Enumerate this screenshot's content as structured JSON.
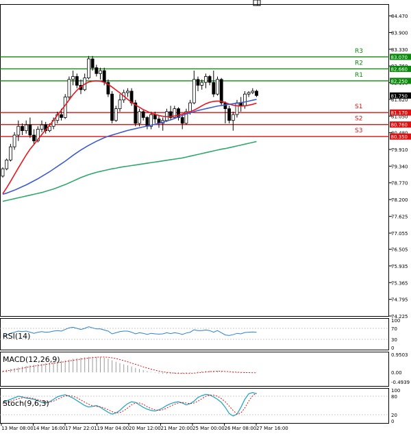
{
  "chart_data": {
    "type": "candlestick",
    "price_axis": {
      "ticks": [
        "84.470",
        "83.900",
        "83.330",
        "82.760",
        "82.190",
        "81.620",
        "81.050",
        "80.480",
        "79.910",
        "79.340",
        "78.770",
        "78.200",
        "77.625",
        "77.055",
        "76.505",
        "75.935",
        "75.365",
        "74.795",
        "74.225"
      ],
      "ylim": [
        74.225,
        84.87
      ]
    },
    "current_price": "81.750",
    "levels": [
      {
        "label": "R3",
        "value": 83.07,
        "tag": "83.070",
        "type": "resistance"
      },
      {
        "label": "R2",
        "value": 82.66,
        "tag": "82.660",
        "type": "resistance"
      },
      {
        "label": "R1",
        "value": 82.25,
        "tag": "82.250",
        "type": "resistance"
      },
      {
        "label": "S1",
        "value": 81.17,
        "tag": "81.170",
        "type": "support"
      },
      {
        "label": "S2",
        "value": 80.76,
        "tag": "80.760",
        "type": "support"
      },
      {
        "label": "S3",
        "value": 80.35,
        "tag": "80.350",
        "type": "support"
      }
    ],
    "time_labels": [
      "13 Mar 08:00",
      "14 Mar 16:00",
      "17 Mar 22:01",
      "19 Mar 04:00",
      "20 Mar 12:00",
      "21 Mar 20:00",
      "25 Mar 00:00",
      "26 Mar 08:00",
      "27 Mar 16:00"
    ],
    "candles": [
      [
        79.0,
        79.3,
        78.95,
        79.25
      ],
      [
        79.25,
        79.6,
        79.2,
        79.55
      ],
      [
        79.55,
        80.1,
        79.5,
        80.0
      ],
      [
        80.0,
        80.5,
        79.9,
        80.4
      ],
      [
        80.4,
        80.9,
        80.2,
        80.7
      ],
      [
        80.7,
        80.8,
        80.4,
        80.55
      ],
      [
        80.55,
        80.9,
        80.45,
        80.75
      ],
      [
        80.75,
        81.0,
        80.3,
        80.4
      ],
      [
        80.4,
        80.6,
        80.1,
        80.2
      ],
      [
        80.2,
        80.7,
        80.15,
        80.6
      ],
      [
        80.6,
        80.9,
        80.5,
        80.75
      ],
      [
        80.75,
        80.85,
        80.45,
        80.55
      ],
      [
        80.55,
        80.8,
        80.5,
        80.7
      ],
      [
        80.7,
        81.0,
        80.6,
        80.9
      ],
      [
        80.9,
        81.2,
        80.8,
        81.1
      ],
      [
        81.1,
        81.3,
        80.9,
        81.0
      ],
      [
        81.0,
        81.8,
        80.95,
        81.7
      ],
      [
        81.7,
        82.4,
        81.6,
        82.3
      ],
      [
        82.3,
        82.6,
        82.1,
        82.4
      ],
      [
        82.4,
        82.5,
        82.0,
        82.1
      ],
      [
        82.1,
        82.3,
        81.8,
        81.95
      ],
      [
        81.95,
        82.5,
        81.9,
        82.35
      ],
      [
        82.35,
        83.1,
        82.3,
        83.0
      ],
      [
        83.0,
        83.1,
        82.6,
        82.7
      ],
      [
        82.7,
        82.8,
        82.4,
        82.5
      ],
      [
        82.5,
        82.7,
        82.3,
        82.6
      ],
      [
        82.6,
        82.7,
        82.1,
        82.2
      ],
      [
        82.2,
        82.3,
        81.7,
        81.8
      ],
      [
        81.8,
        81.9,
        80.8,
        80.9
      ],
      [
        80.9,
        81.4,
        80.85,
        81.3
      ],
      [
        81.3,
        81.8,
        81.2,
        81.6
      ],
      [
        81.6,
        81.95,
        81.5,
        81.85
      ],
      [
        81.85,
        82.0,
        81.7,
        81.9
      ],
      [
        81.9,
        82.0,
        81.4,
        81.5
      ],
      [
        81.5,
        81.6,
        80.7,
        80.8
      ],
      [
        80.8,
        81.3,
        80.7,
        81.2
      ],
      [
        81.2,
        81.25,
        80.9,
        81.0
      ],
      [
        81.0,
        81.05,
        80.6,
        80.7
      ],
      [
        80.7,
        81.2,
        80.6,
        81.1
      ],
      [
        81.1,
        81.2,
        80.8,
        80.95
      ],
      [
        80.95,
        81.05,
        80.65,
        80.8
      ],
      [
        80.8,
        81.0,
        80.55,
        80.9
      ],
      [
        80.9,
        81.3,
        80.85,
        81.2
      ],
      [
        81.2,
        81.4,
        80.9,
        81.0
      ],
      [
        81.0,
        81.4,
        80.95,
        81.3
      ],
      [
        81.3,
        81.35,
        80.9,
        81.0
      ],
      [
        81.0,
        81.1,
        80.6,
        80.8
      ],
      [
        80.8,
        81.3,
        80.75,
        81.2
      ],
      [
        81.2,
        81.6,
        81.1,
        81.5
      ],
      [
        81.5,
        82.6,
        81.45,
        82.3
      ],
      [
        82.3,
        82.4,
        81.9,
        82.1
      ],
      [
        82.1,
        82.3,
        81.95,
        82.2
      ],
      [
        82.2,
        82.5,
        82.0,
        82.4
      ],
      [
        82.4,
        82.45,
        82.1,
        82.2
      ],
      [
        82.2,
        82.6,
        81.7,
        81.8
      ],
      [
        81.8,
        82.4,
        81.75,
        82.3
      ],
      [
        82.3,
        82.35,
        81.4,
        81.5
      ],
      [
        81.5,
        81.55,
        80.8,
        81.3
      ],
      [
        81.3,
        81.4,
        80.8,
        80.9
      ],
      [
        80.9,
        81.2,
        80.55,
        81.1
      ],
      [
        81.1,
        81.6,
        81.0,
        81.5
      ],
      [
        81.5,
        81.7,
        81.2,
        81.4
      ],
      [
        81.4,
        81.9,
        81.3,
        81.8
      ],
      [
        81.8,
        81.9,
        81.7,
        81.85
      ],
      [
        81.85,
        82.0,
        81.8,
        81.9
      ],
      [
        81.9,
        81.95,
        81.7,
        81.75
      ]
    ],
    "series": [
      {
        "name": "MA fast",
        "color": "#e8141e",
        "values": [
          78.4,
          78.6,
          78.82,
          79.05,
          79.28,
          79.5,
          79.72,
          79.92,
          80.08,
          80.25,
          80.42,
          80.58,
          80.74,
          80.9,
          81.08,
          81.25,
          81.42,
          81.6,
          81.78,
          81.93,
          82.05,
          82.14,
          82.21,
          82.24,
          82.25,
          82.24,
          82.2,
          82.13,
          82.04,
          81.94,
          81.84,
          81.73,
          81.62,
          81.52,
          81.43,
          81.35,
          81.27,
          81.21,
          81.15,
          81.11,
          81.07,
          81.04,
          81.03,
          81.03,
          81.05,
          81.08,
          81.12,
          81.16,
          81.2,
          81.25,
          81.32,
          81.4,
          81.47,
          81.52,
          81.55,
          81.56,
          81.55,
          81.51,
          81.46,
          81.42,
          81.4,
          81.39,
          81.4,
          81.42,
          81.45,
          81.49
        ]
      },
      {
        "name": "MA mid",
        "color": "#3c5ad2",
        "values": [
          78.38,
          78.42,
          78.47,
          78.52,
          78.58,
          78.64,
          78.7,
          78.77,
          78.84,
          78.91,
          78.99,
          79.07,
          79.15,
          79.24,
          79.33,
          79.42,
          79.51,
          79.61,
          79.71,
          79.8,
          79.89,
          79.97,
          80.05,
          80.12,
          80.19,
          80.25,
          80.31,
          80.36,
          80.4,
          80.44,
          80.48,
          80.52,
          80.56,
          80.59,
          80.62,
          80.65,
          80.68,
          80.71,
          80.74,
          80.77,
          80.8,
          80.84,
          80.88,
          80.92,
          80.97,
          81.02,
          81.07,
          81.12,
          81.16,
          81.2,
          81.24,
          81.27,
          81.3,
          81.33,
          81.36,
          81.39,
          81.41,
          81.43,
          81.45,
          81.47,
          81.49,
          81.51,
          81.53,
          81.56,
          81.59,
          81.62
        ]
      },
      {
        "name": "MA slow",
        "color": "#2ea86a",
        "values": [
          78.14,
          78.17,
          78.2,
          78.23,
          78.26,
          78.29,
          78.32,
          78.35,
          78.38,
          78.41,
          78.44,
          78.48,
          78.52,
          78.56,
          78.61,
          78.66,
          78.71,
          78.77,
          78.83,
          78.89,
          78.95,
          79.0,
          79.05,
          79.09,
          79.13,
          79.16,
          79.19,
          79.22,
          79.25,
          79.27,
          79.3,
          79.32,
          79.34,
          79.36,
          79.38,
          79.4,
          79.42,
          79.44,
          79.46,
          79.48,
          79.5,
          79.52,
          79.54,
          79.56,
          79.58,
          79.6,
          79.62,
          79.65,
          79.68,
          79.71,
          79.74,
          79.77,
          79.8,
          79.83,
          79.86,
          79.89,
          79.92,
          79.94,
          79.97,
          80.0,
          80.03,
          80.06,
          80.09,
          80.12,
          80.15,
          80.18
        ]
      }
    ],
    "indicators": {
      "rsi": {
        "label": "RSI(14)",
        "ticks": [
          "100",
          "70",
          "30",
          "0"
        ],
        "ylim": [
          0,
          100
        ],
        "values": [
          42,
          46,
          52,
          56,
          60,
          58,
          60,
          56,
          52,
          56,
          58,
          56,
          57,
          60,
          62,
          60,
          66,
          72,
          74,
          70,
          66,
          70,
          76,
          72,
          68,
          68,
          64,
          60,
          50,
          54,
          58,
          60,
          60,
          56,
          50,
          54,
          52,
          48,
          52,
          50,
          49,
          50,
          54,
          51,
          54,
          52,
          48,
          53,
          56,
          65,
          62,
          62,
          64,
          62,
          56,
          62,
          54,
          46,
          44,
          47,
          52,
          50,
          55,
          56,
          57,
          56
        ]
      },
      "macd": {
        "label": "MACD(12,26,9)",
        "ticks": [
          "0.9503",
          "0.00",
          "-0.4939"
        ],
        "ylim": [
          -0.5,
          0.95
        ],
        "histogram": [
          0.1,
          0.14,
          0.18,
          0.22,
          0.26,
          0.3,
          0.34,
          0.37,
          0.4,
          0.43,
          0.46,
          0.49,
          0.52,
          0.55,
          0.58,
          0.61,
          0.64,
          0.68,
          0.72,
          0.75,
          0.78,
          0.8,
          0.82,
          0.83,
          0.82,
          0.8,
          0.77,
          0.72,
          0.64,
          0.56,
          0.49,
          0.43,
          0.37,
          0.31,
          0.24,
          0.18,
          0.12,
          0.07,
          0.02,
          -0.02,
          -0.05,
          -0.07,
          -0.08,
          -0.08,
          -0.07,
          -0.06,
          -0.06,
          -0.05,
          -0.03,
          0.01,
          0.04,
          0.06,
          0.08,
          0.09,
          0.08,
          0.08,
          0.05,
          0.01,
          -0.02,
          -0.04,
          -0.04,
          -0.04,
          -0.03,
          -0.02,
          -0.01,
          -0.01
        ],
        "signal": [
          0.05,
          0.08,
          0.11,
          0.15,
          0.18,
          0.22,
          0.26,
          0.3,
          0.33,
          0.36,
          0.39,
          0.42,
          0.45,
          0.48,
          0.51,
          0.54,
          0.57,
          0.6,
          0.64,
          0.67,
          0.7,
          0.73,
          0.76,
          0.78,
          0.8,
          0.81,
          0.81,
          0.8,
          0.77,
          0.73,
          0.68,
          0.62,
          0.56,
          0.49,
          0.43,
          0.36,
          0.29,
          0.23,
          0.17,
          0.12,
          0.07,
          0.03,
          0.0,
          -0.02,
          -0.04,
          -0.05,
          -0.05,
          -0.05,
          -0.05,
          -0.04,
          -0.02,
          0.0,
          0.02,
          0.04,
          0.05,
          0.06,
          0.06,
          0.05,
          0.04,
          0.02,
          0.01,
          0.0,
          -0.01,
          -0.01,
          -0.02,
          -0.02
        ]
      },
      "stoch": {
        "label": "Stoch(9,6,3)",
        "ticks": [
          "100",
          "80",
          "20",
          "0"
        ],
        "ylim": [
          0,
          100
        ],
        "k": [
          60,
          65,
          70,
          75,
          80,
          78,
          74,
          72,
          70,
          66,
          60,
          58,
          62,
          70,
          78,
          82,
          85,
          80,
          74,
          66,
          58,
          50,
          45,
          47,
          50,
          44,
          36,
          28,
          22,
          26,
          34,
          46,
          56,
          62,
          60,
          52,
          44,
          38,
          34,
          32,
          36,
          42,
          50,
          56,
          60,
          62,
          58,
          52,
          56,
          64,
          76,
          82,
          86,
          84,
          78,
          70,
          60,
          44,
          24,
          16,
          22,
          44,
          70,
          88,
          92,
          88
        ],
        "d": [
          56,
          60,
          64,
          68,
          72,
          75,
          76,
          75,
          72,
          69,
          65,
          62,
          61,
          64,
          70,
          76,
          81,
          82,
          80,
          75,
          68,
          61,
          54,
          49,
          47,
          46,
          42,
          36,
          30,
          26,
          27,
          33,
          42,
          52,
          58,
          58,
          54,
          46,
          40,
          36,
          34,
          36,
          42,
          48,
          54,
          58,
          60,
          58,
          56,
          58,
          64,
          72,
          80,
          84,
          84,
          80,
          72,
          62,
          48,
          34,
          22,
          26,
          42,
          64,
          82,
          90
        ]
      }
    }
  }
}
